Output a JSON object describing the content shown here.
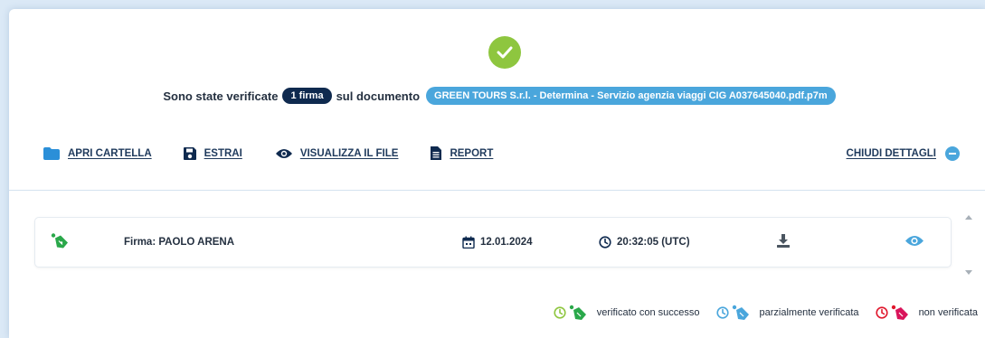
{
  "summary": {
    "prefix": "Sono state verificate",
    "count_badge": "1 firma",
    "middle": "sul documento",
    "file_name": "GREEN TOURS S.r.l. - Determina - Servizio agenzia viaggi CIG A037645040.pdf.p7m"
  },
  "toolbar": {
    "open_folder": "APRI CARTELLA",
    "extract": "ESTRAI",
    "view_file": "VISUALIZZA IL FILE",
    "report": "REPORT",
    "close_details": "CHIUDI DETTAGLI"
  },
  "signatures": [
    {
      "name": "Firma: PAOLO ARENA",
      "date": "12.01.2024",
      "time": "20:32:05 (UTC)",
      "status": "verificato con successo"
    }
  ],
  "legend": {
    "success": "verificato con successo",
    "partial": "parzialmente verificata",
    "failed": "non verificata"
  },
  "colors": {
    "success": "#8ec63f",
    "success_pen": "#2aa84a",
    "partial": "#4aa6dc",
    "failed": "#e0182d",
    "failed_pen": "#d9145a",
    "navy": "#0f2a4f",
    "accent": "#4aa6dc"
  },
  "icons": {
    "status": "check-icon",
    "open_folder": "folder-icon",
    "extract": "save-icon",
    "view_file": "eye-icon",
    "report": "document-icon",
    "close_details": "minus-circle-icon",
    "date": "calendar-icon",
    "time": "clock-icon",
    "download": "download-icon",
    "view_signature": "eye-icon"
  }
}
